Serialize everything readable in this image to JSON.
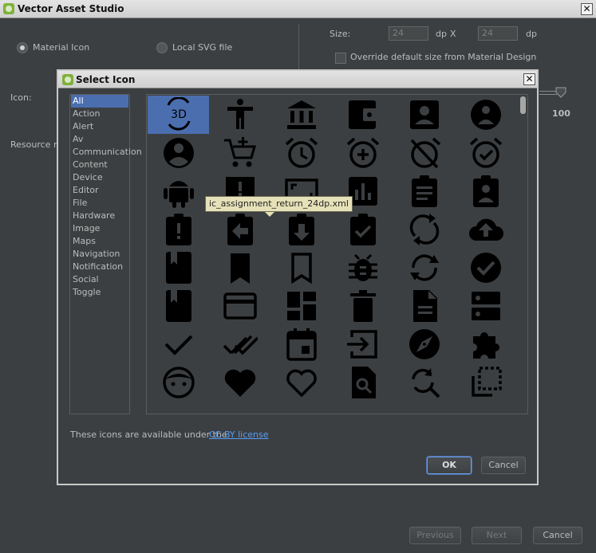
{
  "main_window": {
    "title": "Vector Asset Studio",
    "source": {
      "material_icon_label": "Material Icon",
      "local_svg_label": "Local SVG file"
    },
    "size_label": "Size:",
    "width_value": "24",
    "height_value": "24",
    "unit_dp": "dp",
    "unit_x": "X",
    "unit_dp2": "dp",
    "override_label": "Override default size from Material Design",
    "icon_label": "Icon:",
    "resource_name_label": "Resource na",
    "opacity_value": "100",
    "buttons": {
      "previous": "Previous",
      "next": "Next",
      "cancel": "Cancel"
    }
  },
  "dialog": {
    "title": "Select Icon",
    "categories": [
      "All",
      "Action",
      "Alert",
      "Av",
      "Communication",
      "Content",
      "Device",
      "Editor",
      "File",
      "Hardware",
      "Image",
      "Maps",
      "Navigation",
      "Notification",
      "Social",
      "Toggle"
    ],
    "selected_category": "All",
    "tooltip": "ic_assignment_return_24dp.xml",
    "license_text": "These icons are available under the",
    "license_link": "CC-BY license",
    "buttons": {
      "ok": "OK",
      "cancel": "Cancel"
    },
    "icons": [
      "3d-rotation-icon",
      "accessibility-icon",
      "account-balance-icon",
      "account-balance-wallet-icon",
      "account-box-icon",
      "account-child-icon",
      "account-circle-icon",
      "add-shopping-cart-icon",
      "alarm-icon",
      "alarm-add-icon",
      "alarm-off-icon",
      "alarm-on-icon",
      "android-icon",
      "announcement-icon",
      "aspect-ratio-icon",
      "assessment-icon",
      "assignment-icon",
      "assignment-ind-icon",
      "assignment-late-icon",
      "assignment-return-icon",
      "assignment-returned-icon",
      "assignment-turned-in-icon",
      "autorenew-icon",
      "backup-icon",
      "book-icon",
      "bookmark-icon",
      "bookmark-outline-icon",
      "bug-report-icon",
      "cached-icon",
      "check-circle-icon",
      "class-icon",
      "credit-card-icon",
      "dashboard-icon",
      "delete-icon",
      "description-icon",
      "dns-icon",
      "done-icon",
      "done-all-icon",
      "event-icon",
      "exit-to-app-icon",
      "explore-icon",
      "extension-icon",
      "face-icon",
      "favorite-icon",
      "favorite-outline-icon",
      "find-in-page-icon",
      "find-replace-icon",
      "flip-to-back-icon"
    ]
  },
  "colors": {
    "background": "#3c3f41",
    "selection": "#4b6eaf",
    "tooltip_bg": "#e6e1b8",
    "icon": "#000000",
    "link": "#589df6"
  }
}
